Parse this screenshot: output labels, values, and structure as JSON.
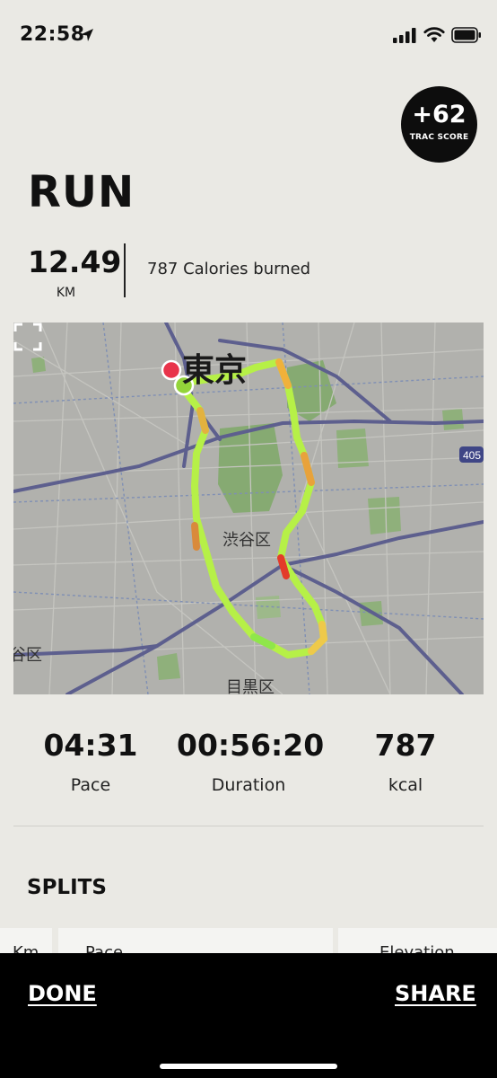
{
  "status_bar": {
    "time": "22:58",
    "icons": [
      "location-arrow-icon",
      "cellular-signal-icon",
      "wifi-icon",
      "battery-icon"
    ]
  },
  "trac_score": {
    "value": "+62",
    "label": "TRAC SCORE"
  },
  "page_title": "RUN",
  "distance": {
    "value": "12.49",
    "unit": "KM"
  },
  "calories_text": "787 Calories burned",
  "map": {
    "labels": {
      "tokyo": "東京",
      "shibuya": "渋谷区",
      "meguro": "目黒区",
      "ward_edge": "谷区"
    },
    "route_badge": "405",
    "expand_icon": "expand-fullscreen-icon"
  },
  "stats": [
    {
      "value": "04:31",
      "label": "Pace"
    },
    {
      "value": "00:56:20",
      "label": "Duration"
    },
    {
      "value": "787",
      "label": "kcal"
    }
  ],
  "splits": {
    "title": "SPLITS",
    "columns": [
      "Km",
      "Pace",
      "Elevation"
    ]
  },
  "bottom_bar": {
    "done_label": "DONE",
    "share_label": "SHARE"
  }
}
